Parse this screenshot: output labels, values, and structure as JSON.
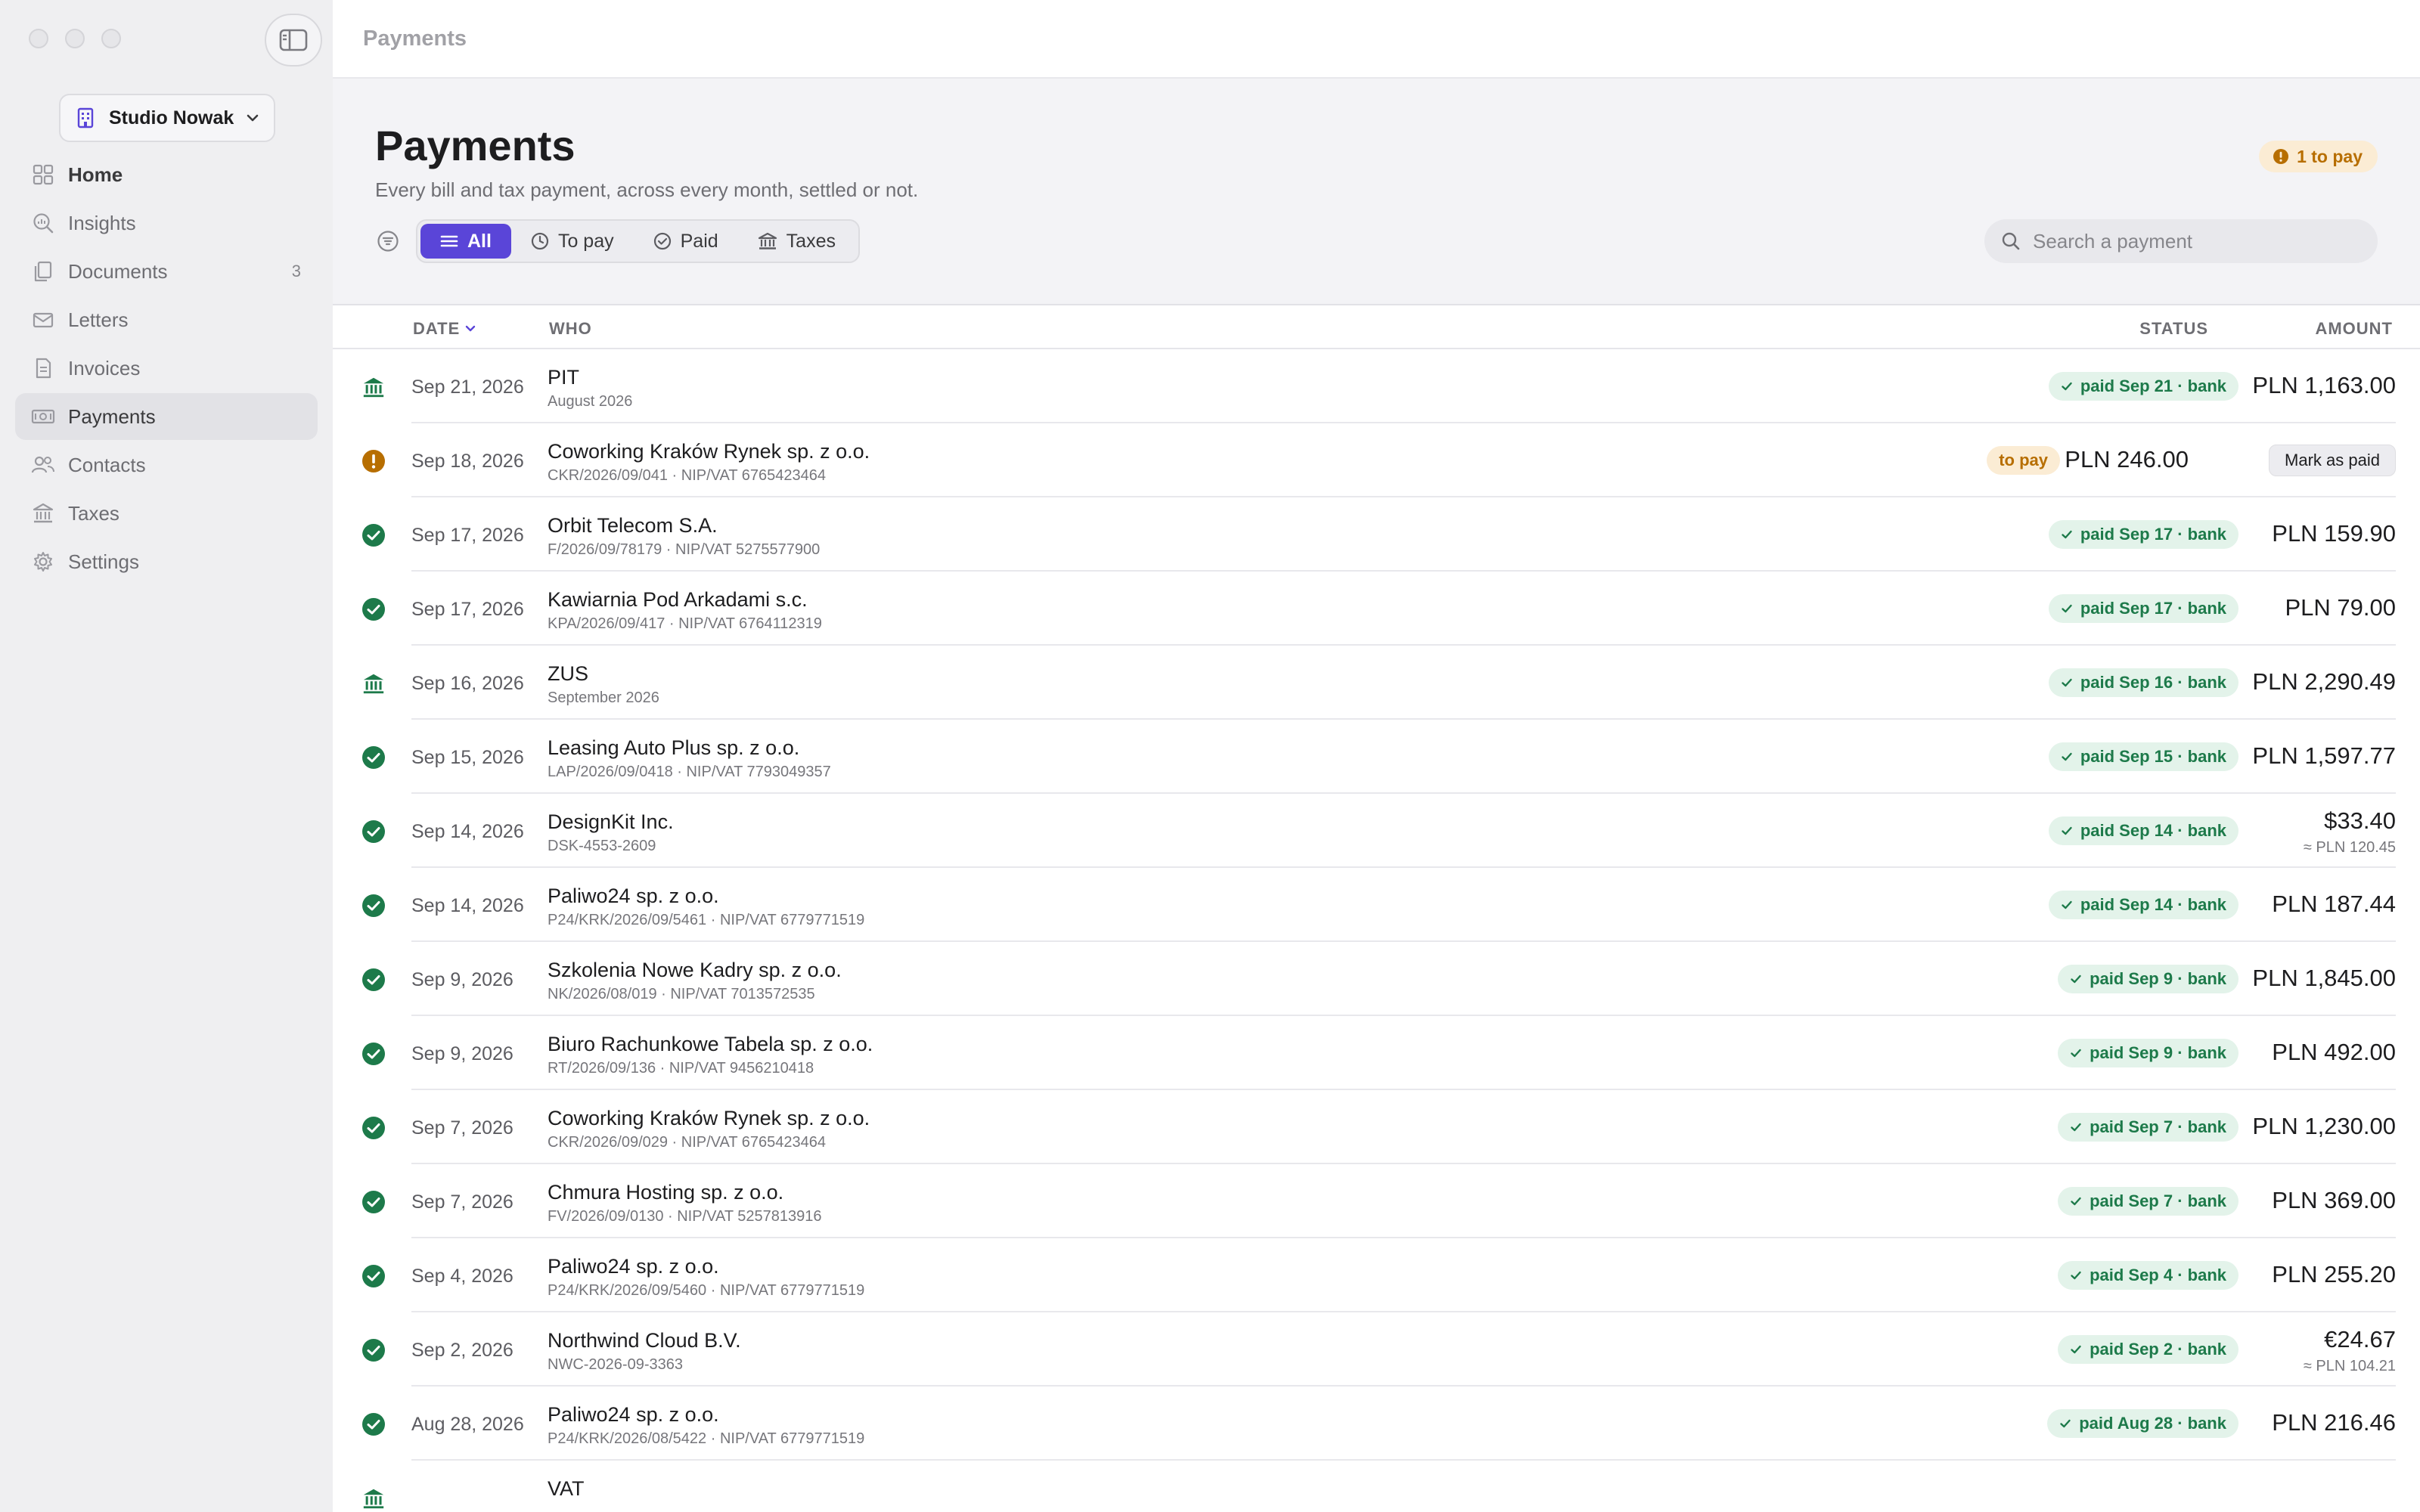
{
  "sidebar": {
    "org_name": "Studio Nowak",
    "items": [
      {
        "label": "Home",
        "icon": "grid-icon"
      },
      {
        "label": "Insights",
        "icon": "magnifier-chart-icon"
      },
      {
        "label": "Documents",
        "icon": "documents-icon",
        "count": "3"
      },
      {
        "label": "Letters",
        "icon": "envelope-icon"
      },
      {
        "label": "Invoices",
        "icon": "invoice-icon"
      },
      {
        "label": "Payments",
        "icon": "banknote-icon",
        "active": true
      },
      {
        "label": "Contacts",
        "icon": "people-icon"
      },
      {
        "label": "Taxes",
        "icon": "bank-icon"
      },
      {
        "label": "Settings",
        "icon": "gear-icon"
      }
    ]
  },
  "topbar": {
    "title": "Payments"
  },
  "header": {
    "title": "Payments",
    "subtitle": "Every bill and tax payment, across every month, settled or not.",
    "to_pay_badge": "1 to pay"
  },
  "filters": {
    "segments": [
      "All",
      "To pay",
      "Paid",
      "Taxes"
    ],
    "selected": "All"
  },
  "search": {
    "placeholder": "Search a payment",
    "value": ""
  },
  "columns": {
    "date": "DATE",
    "who": "WHO",
    "status": "STATUS",
    "amount": "AMOUNT"
  },
  "colors": {
    "accent": "#5a45d8",
    "paid": "#1d7a4a",
    "pending": "#b76e00"
  },
  "rows": [
    {
      "type": "tax",
      "date": "Sep 21, 2026",
      "name": "PIT",
      "ref": "August 2026",
      "status": "paid Sep 21 · bank",
      "amount": "PLN 1,163.00"
    },
    {
      "type": "pending",
      "date": "Sep 18, 2026",
      "name": "Coworking Kraków Rynek sp. z o.o.",
      "ref": "CKR/2026/09/041 · NIP/VAT 6765423464",
      "status": "to pay",
      "amount": "PLN 246.00",
      "action": "Mark as paid"
    },
    {
      "type": "paid",
      "date": "Sep 17, 2026",
      "name": "Orbit Telecom S.A.",
      "ref": "F/2026/09/78179 · NIP/VAT 5275577900",
      "status": "paid Sep 17 · bank",
      "amount": "PLN 159.90"
    },
    {
      "type": "paid",
      "date": "Sep 17, 2026",
      "name": "Kawiarnia Pod Arkadami s.c.",
      "ref": "KPA/2026/09/417 · NIP/VAT 6764112319",
      "status": "paid Sep 17 · bank",
      "amount": "PLN 79.00"
    },
    {
      "type": "tax",
      "date": "Sep 16, 2026",
      "name": "ZUS",
      "ref": "September 2026",
      "status": "paid Sep 16 · bank",
      "amount": "PLN 2,290.49"
    },
    {
      "type": "paid",
      "date": "Sep 15, 2026",
      "name": "Leasing Auto Plus sp. z o.o.",
      "ref": "LAP/2026/09/0418 · NIP/VAT 7793049357",
      "status": "paid Sep 15 · bank",
      "amount": "PLN 1,597.77"
    },
    {
      "type": "paid",
      "date": "Sep 14, 2026",
      "name": "DesignKit Inc.",
      "ref": "DSK-4553-2609",
      "status": "paid Sep 14 · bank",
      "amount": "$33.40",
      "converted": "≈ PLN 120.45"
    },
    {
      "type": "paid",
      "date": "Sep 14, 2026",
      "name": "Paliwo24 sp. z o.o.",
      "ref": "P24/KRK/2026/09/5461 · NIP/VAT 6779771519",
      "status": "paid Sep 14 · bank",
      "amount": "PLN 187.44"
    },
    {
      "type": "paid",
      "date": "Sep 9, 2026",
      "name": "Szkolenia Nowe Kadry sp. z o.o.",
      "ref": "NK/2026/08/019 · NIP/VAT 7013572535",
      "status": "paid Sep 9 · bank",
      "amount": "PLN 1,845.00"
    },
    {
      "type": "paid",
      "date": "Sep 9, 2026",
      "name": "Biuro Rachunkowe Tabela sp. z o.o.",
      "ref": "RT/2026/09/136 · NIP/VAT 9456210418",
      "status": "paid Sep 9 · bank",
      "amount": "PLN 492.00"
    },
    {
      "type": "paid",
      "date": "Sep 7, 2026",
      "name": "Coworking Kraków Rynek sp. z o.o.",
      "ref": "CKR/2026/09/029 · NIP/VAT 6765423464",
      "status": "paid Sep 7 · bank",
      "amount": "PLN 1,230.00"
    },
    {
      "type": "paid",
      "date": "Sep 7, 2026",
      "name": "Chmura Hosting sp. z o.o.",
      "ref": "FV/2026/09/0130 · NIP/VAT 5257813916",
      "status": "paid Sep 7 · bank",
      "amount": "PLN 369.00"
    },
    {
      "type": "paid",
      "date": "Sep 4, 2026",
      "name": "Paliwo24 sp. z o.o.",
      "ref": "P24/KRK/2026/09/5460 · NIP/VAT 6779771519",
      "status": "paid Sep 4 · bank",
      "amount": "PLN 255.20"
    },
    {
      "type": "paid",
      "date": "Sep 2, 2026",
      "name": "Northwind Cloud B.V.",
      "ref": "NWC-2026-09-3363",
      "status": "paid Sep 2 · bank",
      "amount": "€24.67",
      "converted": "≈ PLN 104.21"
    },
    {
      "type": "paid",
      "date": "Aug 28, 2026",
      "name": "Paliwo24 sp. z o.o.",
      "ref": "P24/KRK/2026/08/5422 · NIP/VAT 6779771519",
      "status": "paid Aug 28 · bank",
      "amount": "PLN 216.46"
    },
    {
      "type": "tax",
      "date": "",
      "name": "VAT",
      "ref": "",
      "status": "",
      "amount": ""
    }
  ]
}
